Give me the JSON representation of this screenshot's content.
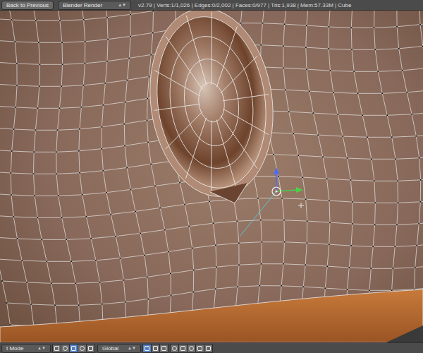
{
  "header": {
    "back_button": "Back to Previous",
    "render_engine": "Blender Render",
    "stats": "v2.79 | Verts:1/1,026 | Edges:0/2,002 | Faces:0/977 | Tris:1,938 | Mem:57.33M | Cube"
  },
  "footer": {
    "mode": "t Mode",
    "orientation": "Global",
    "view_buttons": [
      {
        "selected": false
      },
      {
        "selected": false
      },
      {
        "selected": true
      },
      {
        "selected": false
      },
      {
        "selected": false
      }
    ],
    "select_modes": [
      {
        "selected": true
      },
      {
        "selected": false
      },
      {
        "selected": false
      }
    ],
    "tool_buttons": [
      {
        "selected": false
      },
      {
        "selected": false
      },
      {
        "selected": false
      },
      {
        "selected": false
      },
      {
        "selected": false
      }
    ]
  }
}
